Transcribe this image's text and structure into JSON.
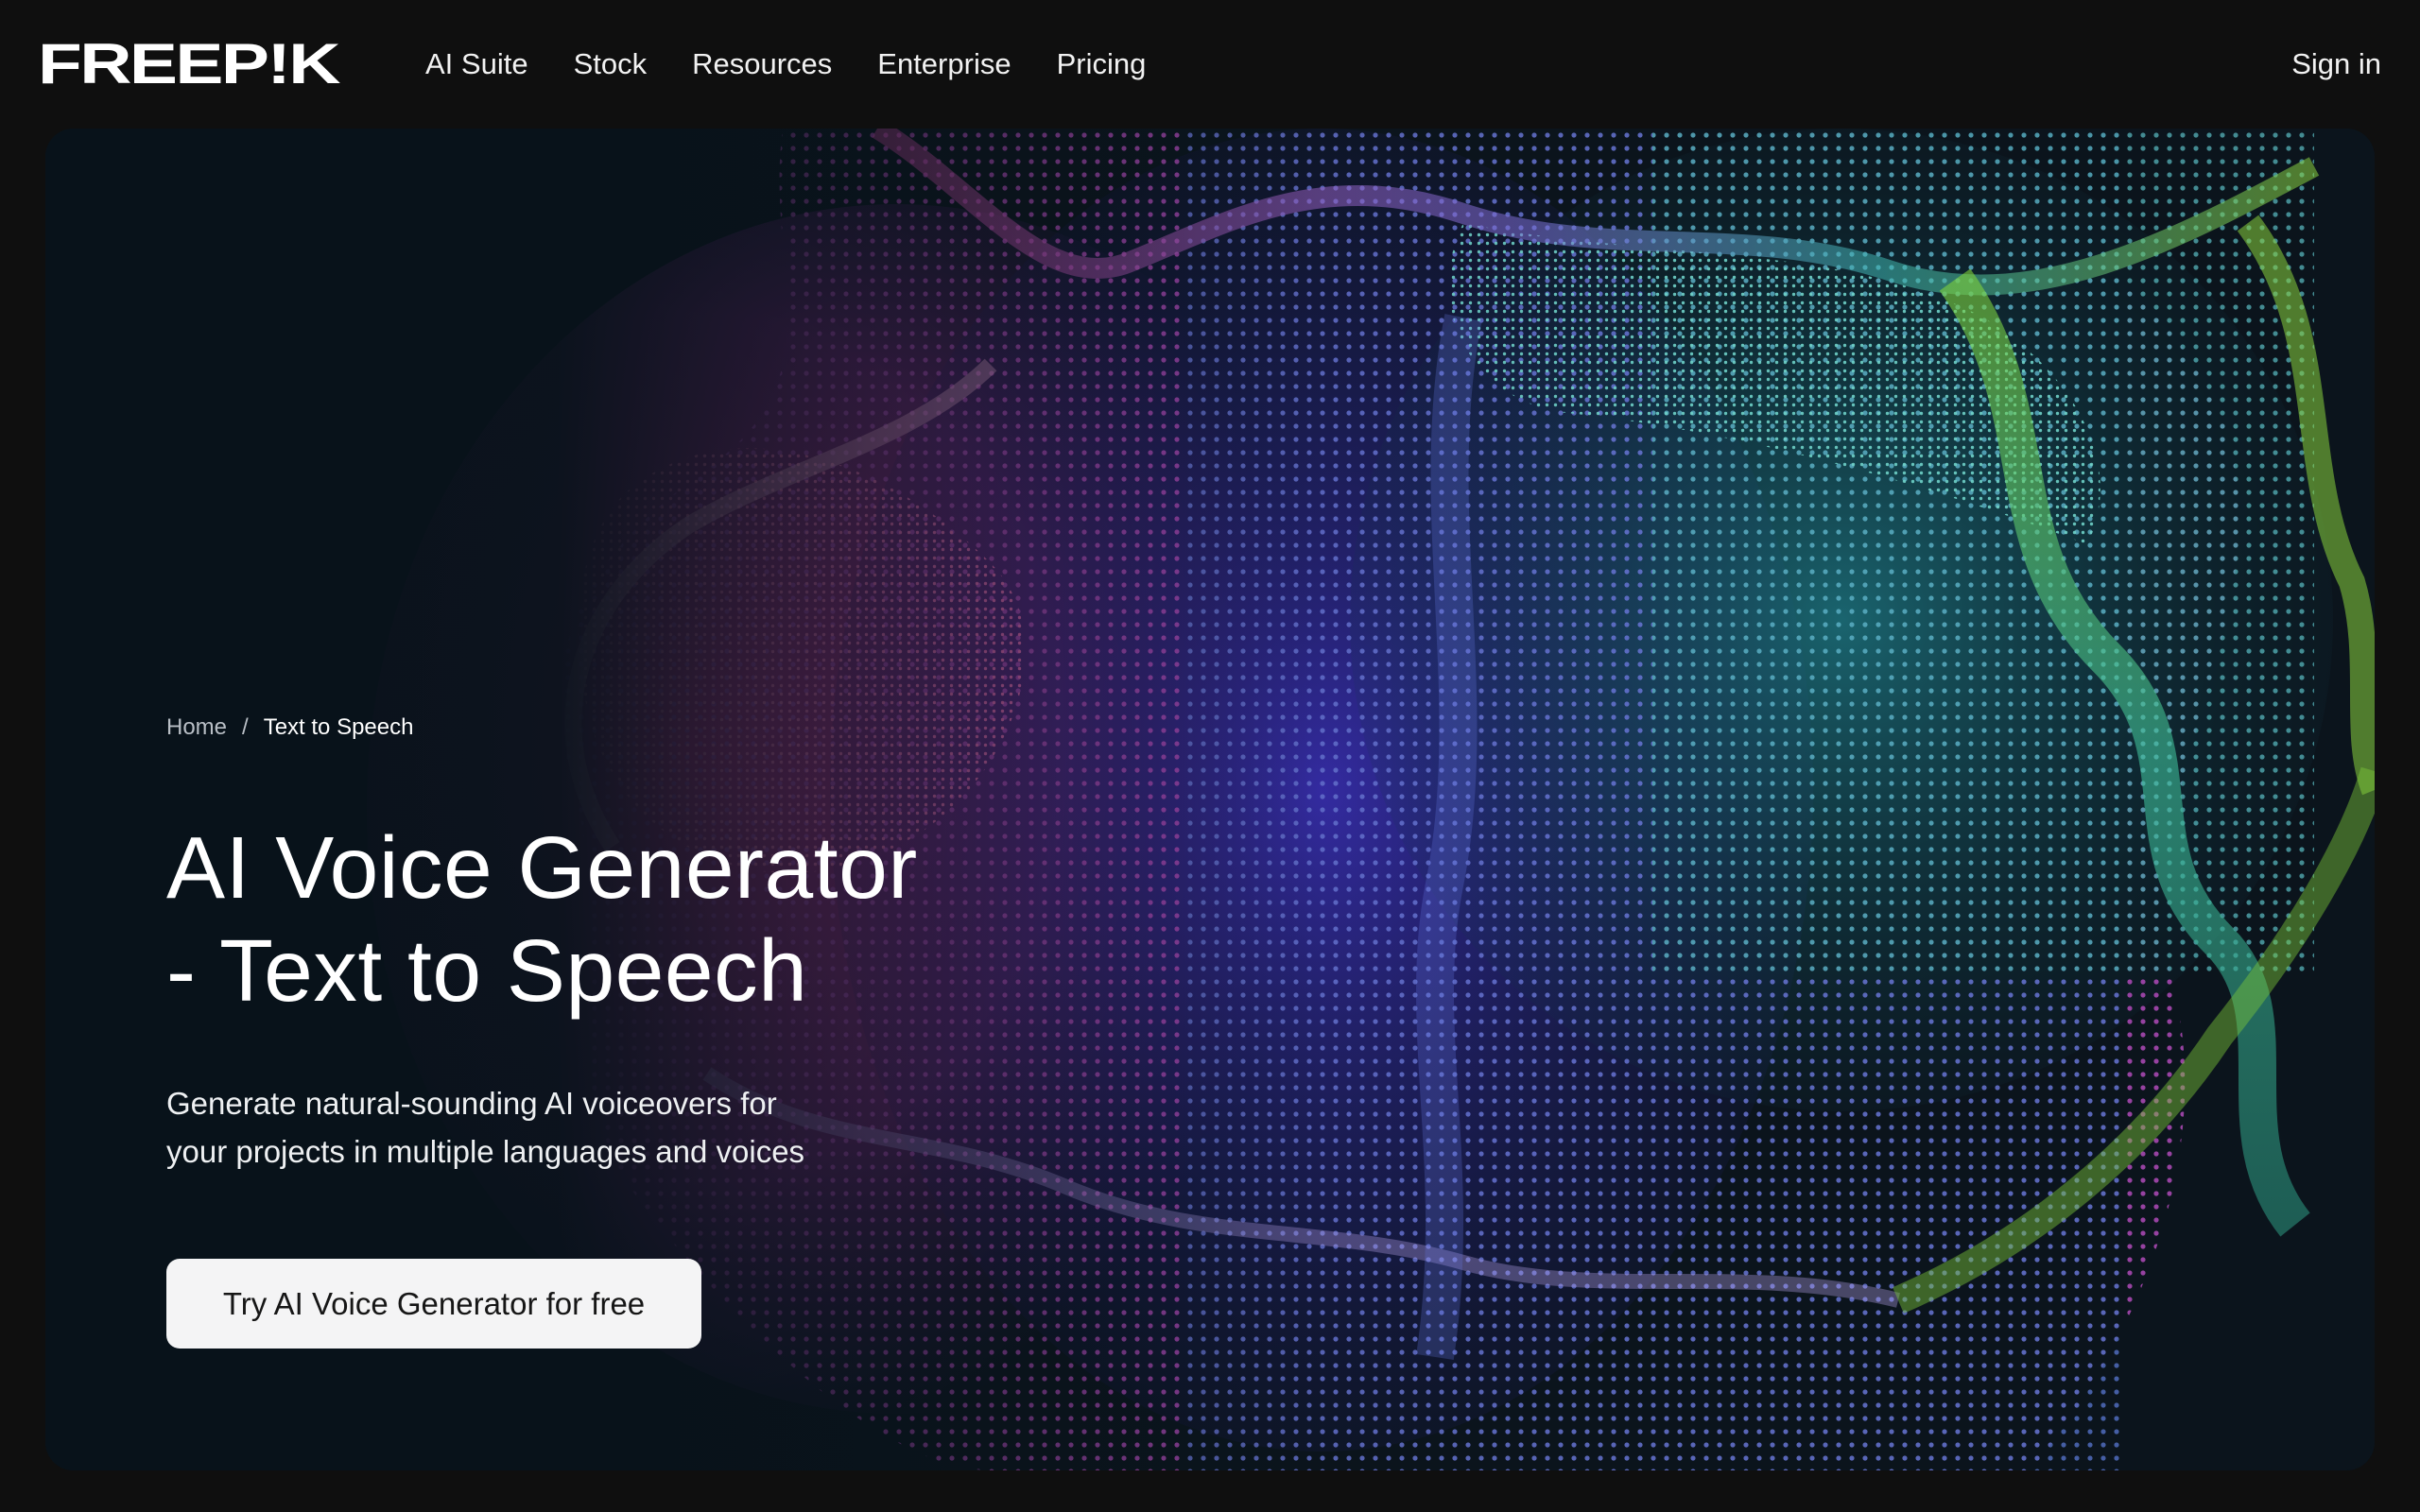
{
  "brand": {
    "name": "FREEPIK",
    "logo_text": "FREEP!K"
  },
  "nav": {
    "links": [
      "AI Suite",
      "Stock",
      "Resources",
      "Enterprise",
      "Pricing"
    ],
    "sign_in": "Sign in"
  },
  "hero": {
    "breadcrumb": {
      "home": "Home",
      "separator": "/",
      "current": "Text to Speech"
    },
    "title_line1": "AI Voice Generator",
    "title_line2": "- Text to Speech",
    "subtitle_line1": "Generate natural-sounding AI voiceovers for",
    "subtitle_line2": "your projects in multiple languages and voices",
    "cta_label": "Try AI Voice Generator for free",
    "background": "dotted-particle-wave-illustration"
  },
  "colors": {
    "page_bg": "#0f0f0f",
    "hero_bg": "#0b141c",
    "magenta": "#c0309a",
    "violet": "#4a2fb0",
    "teal": "#2aa3a0",
    "lime": "#7cc73a",
    "cta_bg": "#f4f4f5"
  }
}
